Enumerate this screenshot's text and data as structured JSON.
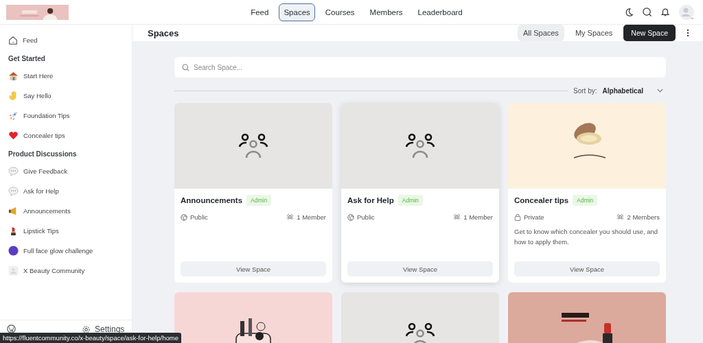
{
  "top_nav": [
    {
      "label": "Feed",
      "selected": false
    },
    {
      "label": "Spaces",
      "selected": true
    },
    {
      "label": "Courses",
      "selected": false
    },
    {
      "label": "Members",
      "selected": false
    },
    {
      "label": "Leaderboard",
      "selected": false
    }
  ],
  "sidebar": {
    "feed": "Feed",
    "groups": [
      {
        "heading": "Get Started",
        "items": [
          "Start Here",
          "Say Hello",
          "Foundation Tips",
          "Concealer tips"
        ]
      },
      {
        "heading": "Product Discussions",
        "items": [
          "Give Feedback",
          "Ask for Help",
          "Announcements",
          "Lipstick Tips",
          "Full face glow challenge",
          "X Beauty Community"
        ]
      }
    ],
    "settings": "Settings"
  },
  "page_title": "Spaces",
  "filter_tabs": [
    {
      "label": "All Spaces",
      "selected": true
    },
    {
      "label": "My Spaces",
      "selected": false
    }
  ],
  "new_button": "New Space",
  "search": {
    "placeholder": "Search Space..."
  },
  "sort": {
    "label": "Sort by:",
    "value": "Alphabetical"
  },
  "cards": [
    {
      "kind": "placeholder",
      "title": "Announcements",
      "badge": "Admin",
      "privacy": "Public",
      "members": "1 Member",
      "button": "View Space",
      "highlighted": false
    },
    {
      "kind": "placeholder",
      "title": "Ask for Help",
      "badge": "Admin",
      "privacy": "Public",
      "members": "1 Member",
      "button": "View Space",
      "highlighted": true
    },
    {
      "kind": "picture",
      "title": "Concealer tips",
      "badge": "Admin",
      "privacy": "Private",
      "members": "2 Members",
      "description": "Get to know which concealer you should use, and how to apply them.",
      "button": "View Space",
      "highlighted": false
    },
    {
      "kind": "picture",
      "highlighted": false
    },
    {
      "kind": "placeholder",
      "highlighted": false
    },
    {
      "kind": "picture",
      "highlighted": false
    }
  ],
  "link_tooltip": "https://fluentcommunity.co/x-beauty/space/ask-for-help/home"
}
